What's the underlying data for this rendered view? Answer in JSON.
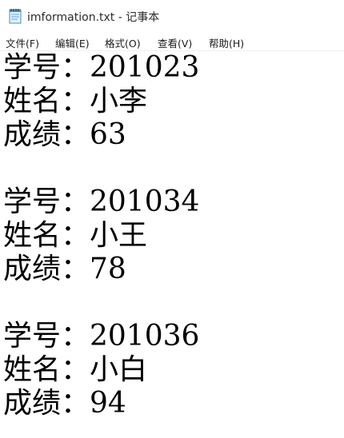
{
  "window": {
    "title": "imformation.txt - 记事本",
    "icon": "notepad-icon"
  },
  "menu": {
    "file": "文件(F)",
    "edit": "编辑(E)",
    "format": "格式(O)",
    "view": "查看(V)",
    "help": "帮助(H)"
  },
  "document": {
    "lines": [
      "学号：201023",
      "姓名：小李",
      "成绩：63",
      "",
      "学号：201034",
      "姓名：小王",
      "成绩：78",
      "",
      "学号：201036",
      "姓名：小白",
      "成绩：94"
    ]
  }
}
